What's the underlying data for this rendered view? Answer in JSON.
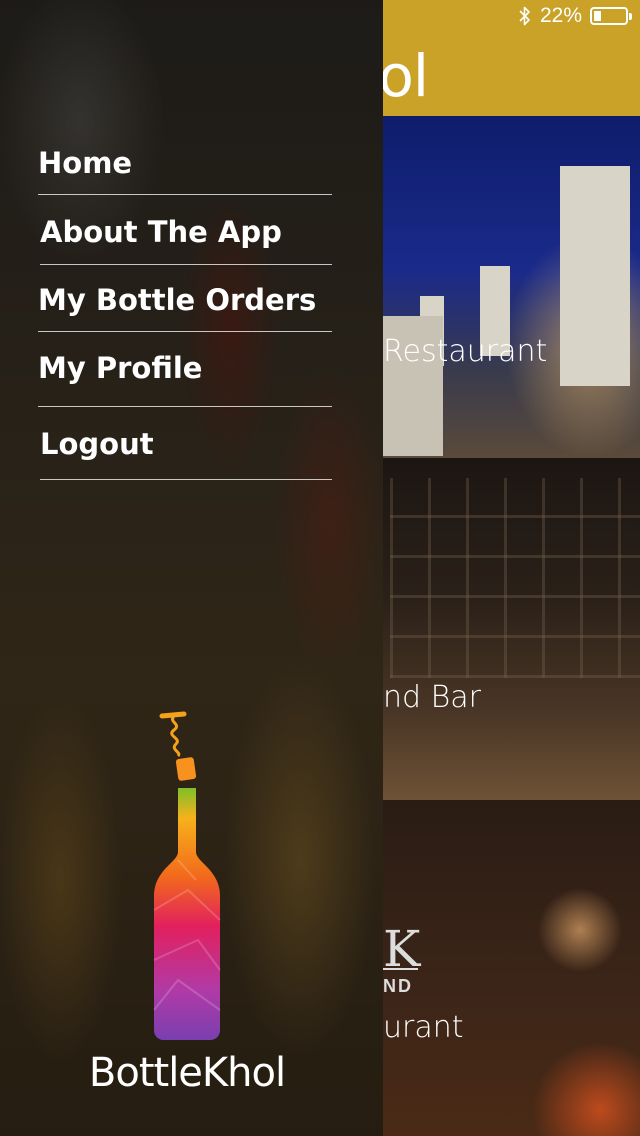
{
  "status_bar": {
    "battery_percent": "22%",
    "battery_level": 0.22,
    "bluetooth_icon": "bluetooth-icon",
    "battery_icon": "battery-icon"
  },
  "app_bar": {
    "title_fragment": "hol"
  },
  "restaurants": [
    {
      "name_fragment": "Restaurant"
    },
    {
      "name_fragment": "nd Bar"
    },
    {
      "name_fragment": "urant",
      "logo_fragment": "K",
      "logo_sub_fragment": "ND"
    }
  ],
  "menu": {
    "items": [
      {
        "label": "Home"
      },
      {
        "label": "About The App"
      },
      {
        "label": "My Bottle Orders"
      },
      {
        "label": "My Profile"
      },
      {
        "label": "Logout"
      }
    ]
  },
  "brand": {
    "name": "BottleKhol",
    "logo_icon": "bottle-logo-icon"
  },
  "colors": {
    "accent": "#c9a227",
    "text": "#ffffff"
  }
}
